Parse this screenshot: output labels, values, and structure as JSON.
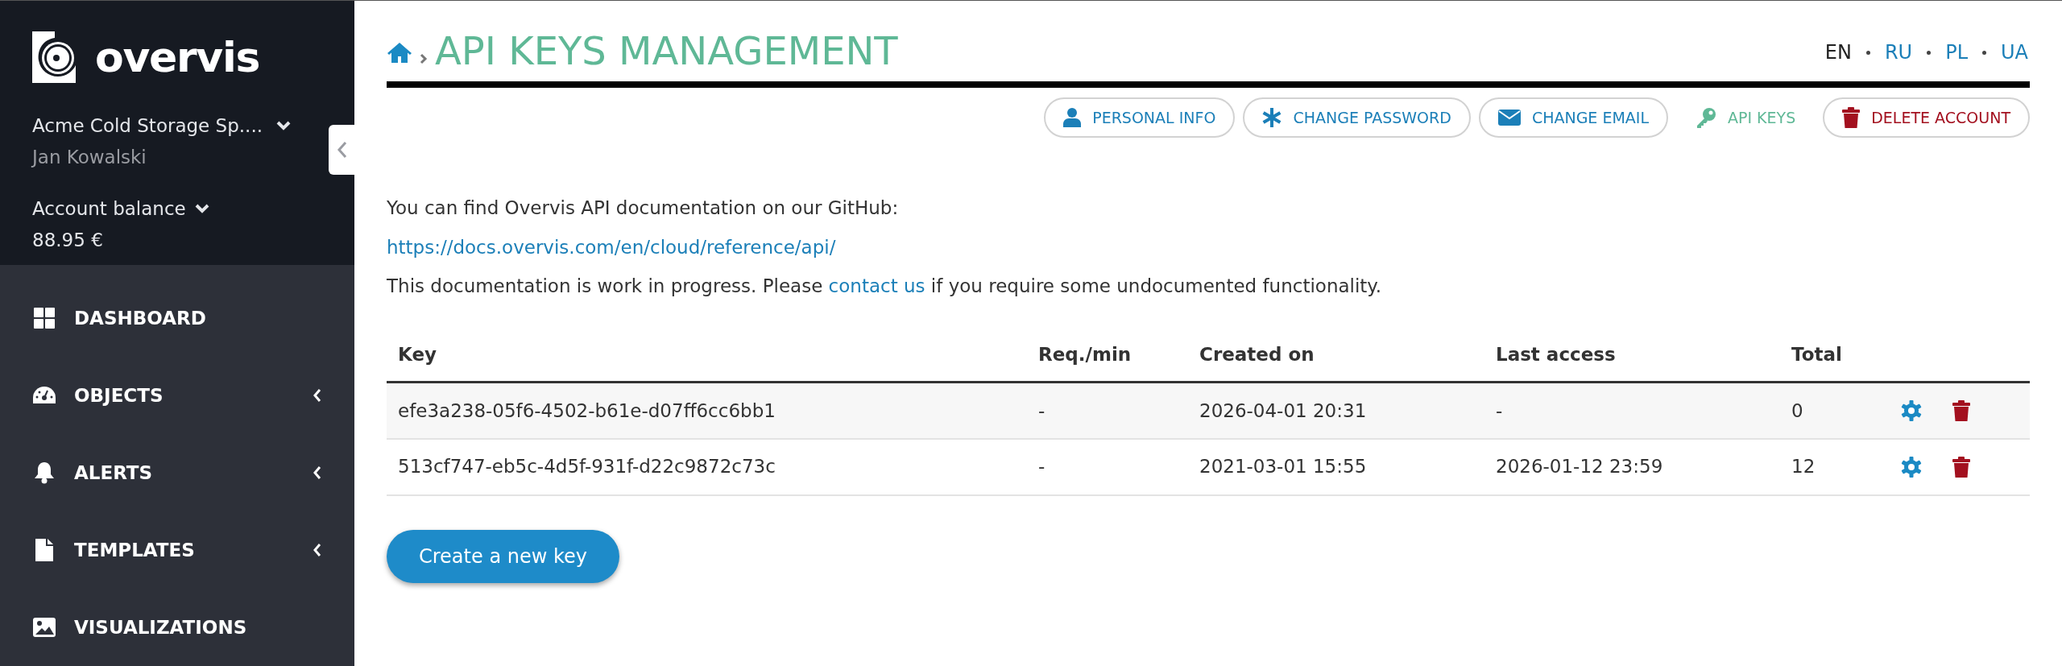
{
  "sidebar": {
    "brand": "overvis",
    "company": "Acme Cold Storage Sp....",
    "user": "Jan Kowalski",
    "balance_label": "Account balance",
    "balance": "88.95 €",
    "menu": [
      {
        "label": "DASHBOARD",
        "kind": "link"
      },
      {
        "label": "OBJECTS",
        "kind": "submenu"
      },
      {
        "label": "ALERTS",
        "kind": "submenu"
      },
      {
        "label": "TEMPLATES",
        "kind": "submenu"
      },
      {
        "label": "VISUALIZATIONS",
        "kind": "link"
      }
    ]
  },
  "page": {
    "title": "API KEYS MANAGEMENT",
    "languages": [
      {
        "label": "EN",
        "selected": true
      },
      {
        "label": "RU",
        "selected": false
      },
      {
        "label": "PL",
        "selected": false
      },
      {
        "label": "UA",
        "selected": false
      }
    ],
    "tabs": [
      {
        "label": "PERSONAL INFO",
        "selected": false,
        "kind": "normal"
      },
      {
        "label": "CHANGE PASSWORD",
        "selected": false,
        "kind": "normal"
      },
      {
        "label": "CHANGE EMAIL",
        "selected": false,
        "kind": "normal"
      },
      {
        "label": "API KEYS",
        "selected": true,
        "kind": "normal"
      },
      {
        "label": "DELETE ACCOUNT",
        "selected": false,
        "kind": "danger"
      }
    ],
    "intro": "You can find Overvis API documentation on our GitHub:",
    "doc_link": "https://docs.overvis.com/en/cloud/reference/api/",
    "note": {
      "before": "This documentation is work in progress. Please ",
      "link": "contact us",
      "after": " if you require some undocumented functionality."
    }
  },
  "table": {
    "columns": [
      "Key",
      "Req./min",
      "Created on",
      "Last access",
      "Total"
    ],
    "rows": [
      {
        "cells": [
          "efe3a238-05f6-4502-b61e-d07ff6cc6bb1",
          "-",
          "2026-04-01 20:31",
          "-",
          "0"
        ]
      },
      {
        "cells": [
          "513cf747-eb5c-4d5f-931f-d22c9872c73c",
          "-",
          "2021-03-01 15:55",
          "2026-01-12 23:59",
          "12"
        ]
      }
    ]
  },
  "create_button": "Create a new key"
}
